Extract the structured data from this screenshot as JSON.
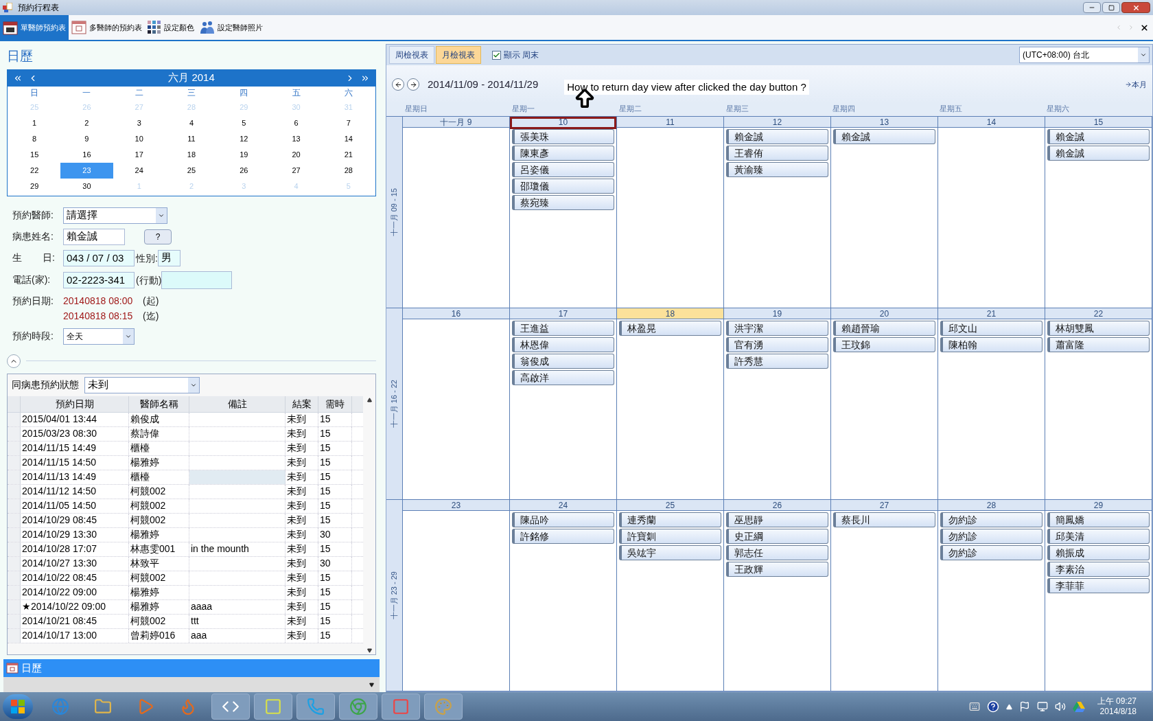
{
  "window": {
    "title": "預約行程表"
  },
  "toolbar": [
    {
      "label": "單醫師預約表",
      "selected": true,
      "kind": "calendar"
    },
    {
      "label": "多醫師的預約表",
      "selected": false,
      "kind": "board"
    },
    {
      "label": "設定顏色",
      "selected": false,
      "kind": "palette"
    },
    {
      "label": "設定醫師照片",
      "selected": false,
      "kind": "people"
    }
  ],
  "calendar": {
    "heading": "日歷",
    "month_label": "六月 2014",
    "weekdays": [
      "日",
      "一",
      "二",
      "三",
      "四",
      "五",
      "六"
    ],
    "days": [
      {
        "text": "25",
        "muted": true,
        "selected": false
      },
      {
        "text": "26",
        "muted": true,
        "selected": false
      },
      {
        "text": "27",
        "muted": true,
        "selected": false
      },
      {
        "text": "28",
        "muted": true,
        "selected": false
      },
      {
        "text": "29",
        "muted": true,
        "selected": false
      },
      {
        "text": "30",
        "muted": true,
        "selected": false
      },
      {
        "text": "31",
        "muted": true,
        "selected": false
      },
      {
        "text": "1",
        "muted": false,
        "selected": false
      },
      {
        "text": "2",
        "muted": false,
        "selected": false
      },
      {
        "text": "3",
        "muted": false,
        "selected": false
      },
      {
        "text": "4",
        "muted": false,
        "selected": false
      },
      {
        "text": "5",
        "muted": false,
        "selected": false
      },
      {
        "text": "6",
        "muted": false,
        "selected": false
      },
      {
        "text": "7",
        "muted": false,
        "selected": false
      },
      {
        "text": "8",
        "muted": false,
        "selected": false
      },
      {
        "text": "9",
        "muted": false,
        "selected": false
      },
      {
        "text": "10",
        "muted": false,
        "selected": false
      },
      {
        "text": "11",
        "muted": false,
        "selected": false
      },
      {
        "text": "12",
        "muted": false,
        "selected": false
      },
      {
        "text": "13",
        "muted": false,
        "selected": false
      },
      {
        "text": "14",
        "muted": false,
        "selected": false
      },
      {
        "text": "15",
        "muted": false,
        "selected": false
      },
      {
        "text": "16",
        "muted": false,
        "selected": false
      },
      {
        "text": "17",
        "muted": false,
        "selected": false
      },
      {
        "text": "18",
        "muted": false,
        "selected": false
      },
      {
        "text": "19",
        "muted": false,
        "selected": false
      },
      {
        "text": "20",
        "muted": false,
        "selected": false
      },
      {
        "text": "21",
        "muted": false,
        "selected": false
      },
      {
        "text": "22",
        "muted": false,
        "selected": false
      },
      {
        "text": "23",
        "muted": false,
        "selected": true
      },
      {
        "text": "24",
        "muted": false,
        "selected": false
      },
      {
        "text": "25",
        "muted": false,
        "selected": false
      },
      {
        "text": "26",
        "muted": false,
        "selected": false
      },
      {
        "text": "27",
        "muted": false,
        "selected": false
      },
      {
        "text": "28",
        "muted": false,
        "selected": false
      },
      {
        "text": "29",
        "muted": false,
        "selected": false
      },
      {
        "text": "30",
        "muted": false,
        "selected": false
      },
      {
        "text": "1",
        "muted": true,
        "selected": false
      },
      {
        "text": "2",
        "muted": true,
        "selected": false
      },
      {
        "text": "3",
        "muted": true,
        "selected": false
      },
      {
        "text": "4",
        "muted": true,
        "selected": false
      },
      {
        "text": "5",
        "muted": true,
        "selected": false
      }
    ]
  },
  "form": {
    "doctor_label": "預約醫師:",
    "doctor_value": "請選擇",
    "patient_label": "病患姓名:",
    "patient_value": "賴金誠",
    "lookup_button": "?",
    "birthday_label_1": "生",
    "birthday_label_2": "日:",
    "birthday_value": "043 / 07 / 03",
    "gender_label": "性別:",
    "gender_value": "男",
    "phone_home_label": "電話(家):",
    "phone_home_value": "02-2223-341",
    "phone_mobile_label": "(行動)",
    "date_label": "預約日期:",
    "start": "20140818 08:00",
    "start_suffix": "(起)",
    "end": "20140818 08:15",
    "end_suffix": "(迄)",
    "slot_label": "預約時段:",
    "slot_value": "全天"
  },
  "history": {
    "label": "同病患預約狀態",
    "filter_value": "未到",
    "columns": [
      "預約日期",
      "醫師名稱",
      "備註",
      "結案",
      "需時"
    ],
    "rows": [
      {
        "cells": [
          "2015/04/01 13:44",
          "賴俊成",
          "",
          "未到",
          "15"
        ],
        "selected": false
      },
      {
        "cells": [
          "2015/03/23 08:30",
          "蔡詩偉",
          "",
          "未到",
          "15"
        ],
        "selected": false
      },
      {
        "cells": [
          "2014/11/15 14:49",
          "櫃檯",
          "",
          "未到",
          "15"
        ],
        "selected": false
      },
      {
        "cells": [
          "2014/11/15 14:50",
          "楊雅婷",
          "",
          "未到",
          "15"
        ],
        "selected": false
      },
      {
        "cells": [
          "2014/11/13 14:49",
          "櫃檯",
          "",
          "未到",
          "15"
        ],
        "selected": true
      },
      {
        "cells": [
          "2014/11/12 14:50",
          "柯競002",
          "",
          "未到",
          "15"
        ],
        "selected": false
      },
      {
        "cells": [
          "2014/11/05 14:50",
          "柯競002",
          "",
          "未到",
          "15"
        ],
        "selected": false
      },
      {
        "cells": [
          "2014/10/29 08:45",
          "柯競002",
          "",
          "未到",
          "15"
        ],
        "selected": false
      },
      {
        "cells": [
          "2014/10/29 13:30",
          "楊雅婷",
          "",
          "未到",
          "30"
        ],
        "selected": false
      },
      {
        "cells": [
          "2014/10/28 17:07",
          "林惠雯001",
          "in the mounth",
          "未到",
          "15"
        ],
        "selected": false
      },
      {
        "cells": [
          "2014/10/27 13:30",
          "林致平",
          "",
          "未到",
          "30"
        ],
        "selected": false
      },
      {
        "cells": [
          "2014/10/22 08:45",
          "柯競002",
          "",
          "未到",
          "15"
        ],
        "selected": false
      },
      {
        "cells": [
          "2014/10/22 09:00",
          "楊雅婷",
          "",
          "未到",
          "15"
        ],
        "selected": false
      },
      {
        "cells": [
          "★2014/10/22 09:00",
          "楊雅婷",
          "aaaa",
          "未到",
          "15"
        ],
        "selected": false
      },
      {
        "cells": [
          "2014/10/21 08:45",
          "柯競002",
          "ttt",
          "未到",
          "15"
        ],
        "selected": false
      },
      {
        "cells": [
          "2014/10/17 13:00",
          "曾莉婷016",
          "aaa",
          "未到",
          "15"
        ],
        "selected": false
      }
    ]
  },
  "bottom_nav": {
    "label": "日歷"
  },
  "schedule": {
    "view_tabs": [
      {
        "label": "周檢視表",
        "selected": false
      },
      {
        "label": "月檢視表",
        "selected": true
      }
    ],
    "show_weekend": {
      "label": "顯示 周末",
      "checked": true
    },
    "timezone": "(UTC+08:00) 台北",
    "date_range": "2014/11/09 - 2014/11/29",
    "question": "How to return day view after clicked the day button ?",
    "this_month": "本月",
    "weekday_labels": [
      "星期日",
      "星期一",
      "星期二",
      "星期三",
      "星期四",
      "星期五",
      "星期六"
    ],
    "weeks": [
      {
        "label": "十一月 09 - 15",
        "days": [
          {
            "label": "十一月 9",
            "today": false,
            "outlined": false
          },
          {
            "label": "10",
            "today": false,
            "outlined": true,
            "appointments": [
              "張美珠",
              "陳東彥",
              "呂姿儀",
              "邵瓊儀",
              "蔡宛臻"
            ]
          },
          {
            "label": "11",
            "today": false,
            "outlined": false
          },
          {
            "label": "12",
            "today": false,
            "outlined": false,
            "appointments": [
              "賴金誠",
              "王睿侑",
              "黃渝臻"
            ]
          },
          {
            "label": "13",
            "today": false,
            "outlined": false,
            "appointments": [
              "賴金誠"
            ]
          },
          {
            "label": "14",
            "today": false,
            "outlined": false
          },
          {
            "label": "15",
            "today": false,
            "outlined": false,
            "appointments": [
              "賴金誠",
              "賴金誠"
            ]
          }
        ]
      },
      {
        "label": "十一月 16 - 22",
        "days": [
          {
            "label": "16",
            "today": false,
            "outlined": false
          },
          {
            "label": "17",
            "today": false,
            "outlined": false,
            "appointments": [
              "王進益",
              "林恩偉",
              "翁俊成",
              "高啟洋"
            ]
          },
          {
            "label": "18",
            "today": true,
            "outlined": false,
            "appointments": [
              "林盈晃"
            ]
          },
          {
            "label": "19",
            "today": false,
            "outlined": false,
            "appointments": [
              "洪宇潔",
              "官有湧",
              "許秀慧"
            ]
          },
          {
            "label": "20",
            "today": false,
            "outlined": false,
            "appointments": [
              "賴趙晉瑜",
              "王玟錦"
            ]
          },
          {
            "label": "21",
            "today": false,
            "outlined": false,
            "appointments": [
              "邱文山",
              "陳柏翰"
            ]
          },
          {
            "label": "22",
            "today": false,
            "outlined": false,
            "appointments": [
              "林胡雙鳳",
              "蕭富隆"
            ]
          }
        ]
      },
      {
        "label": "十一月 23 - 29",
        "days": [
          {
            "label": "23",
            "today": false,
            "outlined": false
          },
          {
            "label": "24",
            "today": false,
            "outlined": false,
            "appointments": [
              "陳品吟",
              "許銘修"
            ]
          },
          {
            "label": "25",
            "today": false,
            "outlined": false,
            "appointments": [
              "連秀蘭",
              "許寶釧",
              "吳竑宇"
            ]
          },
          {
            "label": "26",
            "today": false,
            "outlined": false,
            "appointments": [
              "巫思靜",
              "史正綱",
              "郭志任",
              "王政輝"
            ]
          },
          {
            "label": "27",
            "today": false,
            "outlined": false,
            "appointments": [
              "蔡長川"
            ]
          },
          {
            "label": "28",
            "today": false,
            "outlined": false,
            "appointments": [
              "勿約診",
              "勿約診",
              "勿約診"
            ]
          },
          {
            "label": "29",
            "today": false,
            "outlined": false,
            "appointments": [
              "簡鳳嬌",
              "邱美清",
              "賴振成",
              "李素治",
              "李菲菲"
            ]
          }
        ]
      }
    ]
  },
  "taskbar": {
    "time": "上午 09:27",
    "date": "2014/8/18"
  }
}
